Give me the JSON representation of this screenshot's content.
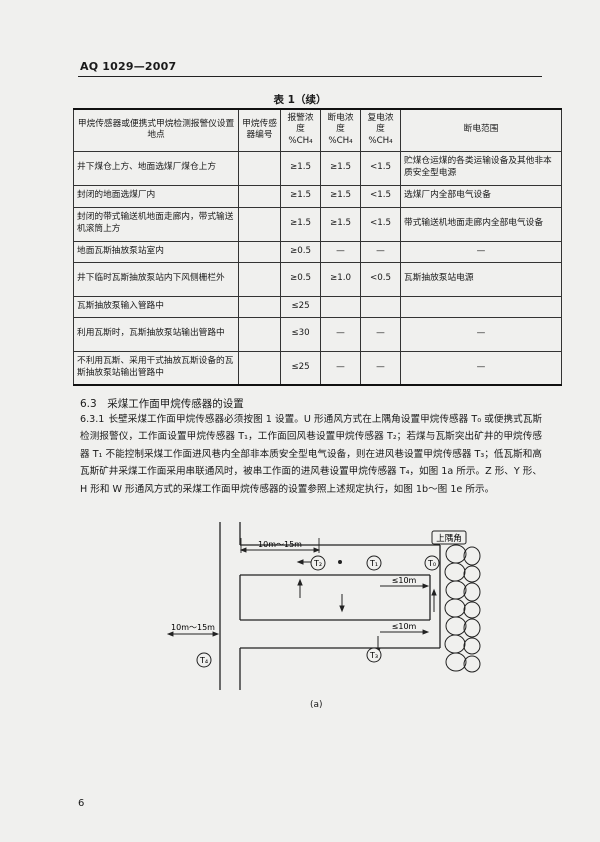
{
  "header": {
    "standard_code": "AQ 1029—2007",
    "page_number": "6"
  },
  "table": {
    "caption": "表 1（续）",
    "columns": [
      "甲烷传感器或便携式甲烷检测报警仪设置地点",
      "甲烷传感器编号",
      "报警浓度 %CH₄",
      "断电浓度 %CH₄",
      "复电浓度 %CH₄",
      "断电范围"
    ],
    "rows": [
      {
        "location": "井下煤仓上方、地面选煤厂煤仓上方",
        "sensor": "",
        "alarm": "≥1.5",
        "cutoff": "≥1.5",
        "restore": "<1.5",
        "range": "贮煤仓运煤的各类运输设备及其他非本质安全型电源"
      },
      {
        "location": "封闭的地面选煤厂内",
        "sensor": "",
        "alarm": "≥1.5",
        "cutoff": "≥1.5",
        "restore": "<1.5",
        "range": "选煤厂内全部电气设备"
      },
      {
        "location": "封闭的带式输送机地面走廊内，带式输送机滚筒上方",
        "sensor": "",
        "alarm": "≥1.5",
        "cutoff": "≥1.5",
        "restore": "<1.5",
        "range": "带式输送机地面走廊内全部电气设备"
      },
      {
        "location": "地面瓦斯抽放泵站室内",
        "sensor": "",
        "alarm": "≥0.5",
        "cutoff": "—",
        "restore": "—",
        "range": "—"
      },
      {
        "location": "井下临时瓦斯抽放泵站内下风侧栅栏外",
        "sensor": "",
        "alarm": "≥0.5",
        "cutoff": "≥1.0",
        "restore": "<0.5",
        "range": "瓦斯抽放泵站电源"
      },
      {
        "location": "瓦斯抽放泵输入管路中",
        "sensor": "",
        "alarm": "≤25",
        "cutoff": "",
        "restore": "",
        "range": ""
      },
      {
        "location": "利用瓦斯时，瓦斯抽放泵站输出管路中",
        "sensor": "",
        "alarm": "≤30",
        "cutoff": "—",
        "restore": "—",
        "range": "—"
      },
      {
        "location": "不利用瓦斯、采用干式抽放瓦斯设备的瓦斯抽放泵站输出管路中",
        "sensor": "",
        "alarm": "≤25",
        "cutoff": "—",
        "restore": "—",
        "range": "—"
      }
    ]
  },
  "section": {
    "heading": "6.3　采煤工作面甲烷传感器的设置",
    "clause_no": "6.3.1",
    "paragraph": "长壁采煤工作面甲烷传感器必须按图 1 设置。U 形通风方式在上隅角设置甲烷传感器 T₀ 或便携式瓦斯检测报警仪，工作面设置甲烷传感器 T₁，工作面回风巷设置甲烷传感器 T₂；若煤与瓦斯突出矿井的甲烷传感器 T₁ 不能控制采煤工作面进风巷内全部非本质安全型电气设备，则在进风巷设置甲烷传感器 T₃；低瓦斯和高瓦斯矿井采煤工作面采用串联通风时，被串工作面的进风巷设置甲烷传感器 T₄，如图 1a 所示。Z 形、Y 形、H 形和 W 形通风方式的采煤工作面甲烷传感器的设置参照上述规定执行，如图 1b～图 1e 所示。"
  },
  "figure": {
    "caption": "(a)",
    "corner_label": "上隅角",
    "distance_upper": "10m～15m",
    "distance_lower": "10m～15m",
    "distance_face_top": "≤10m",
    "distance_face_bottom": "≤10m",
    "sensors": {
      "t0": "T₀",
      "t1": "T₁",
      "t2": "T₂",
      "t3": "T₃",
      "t4": "T₄"
    }
  }
}
